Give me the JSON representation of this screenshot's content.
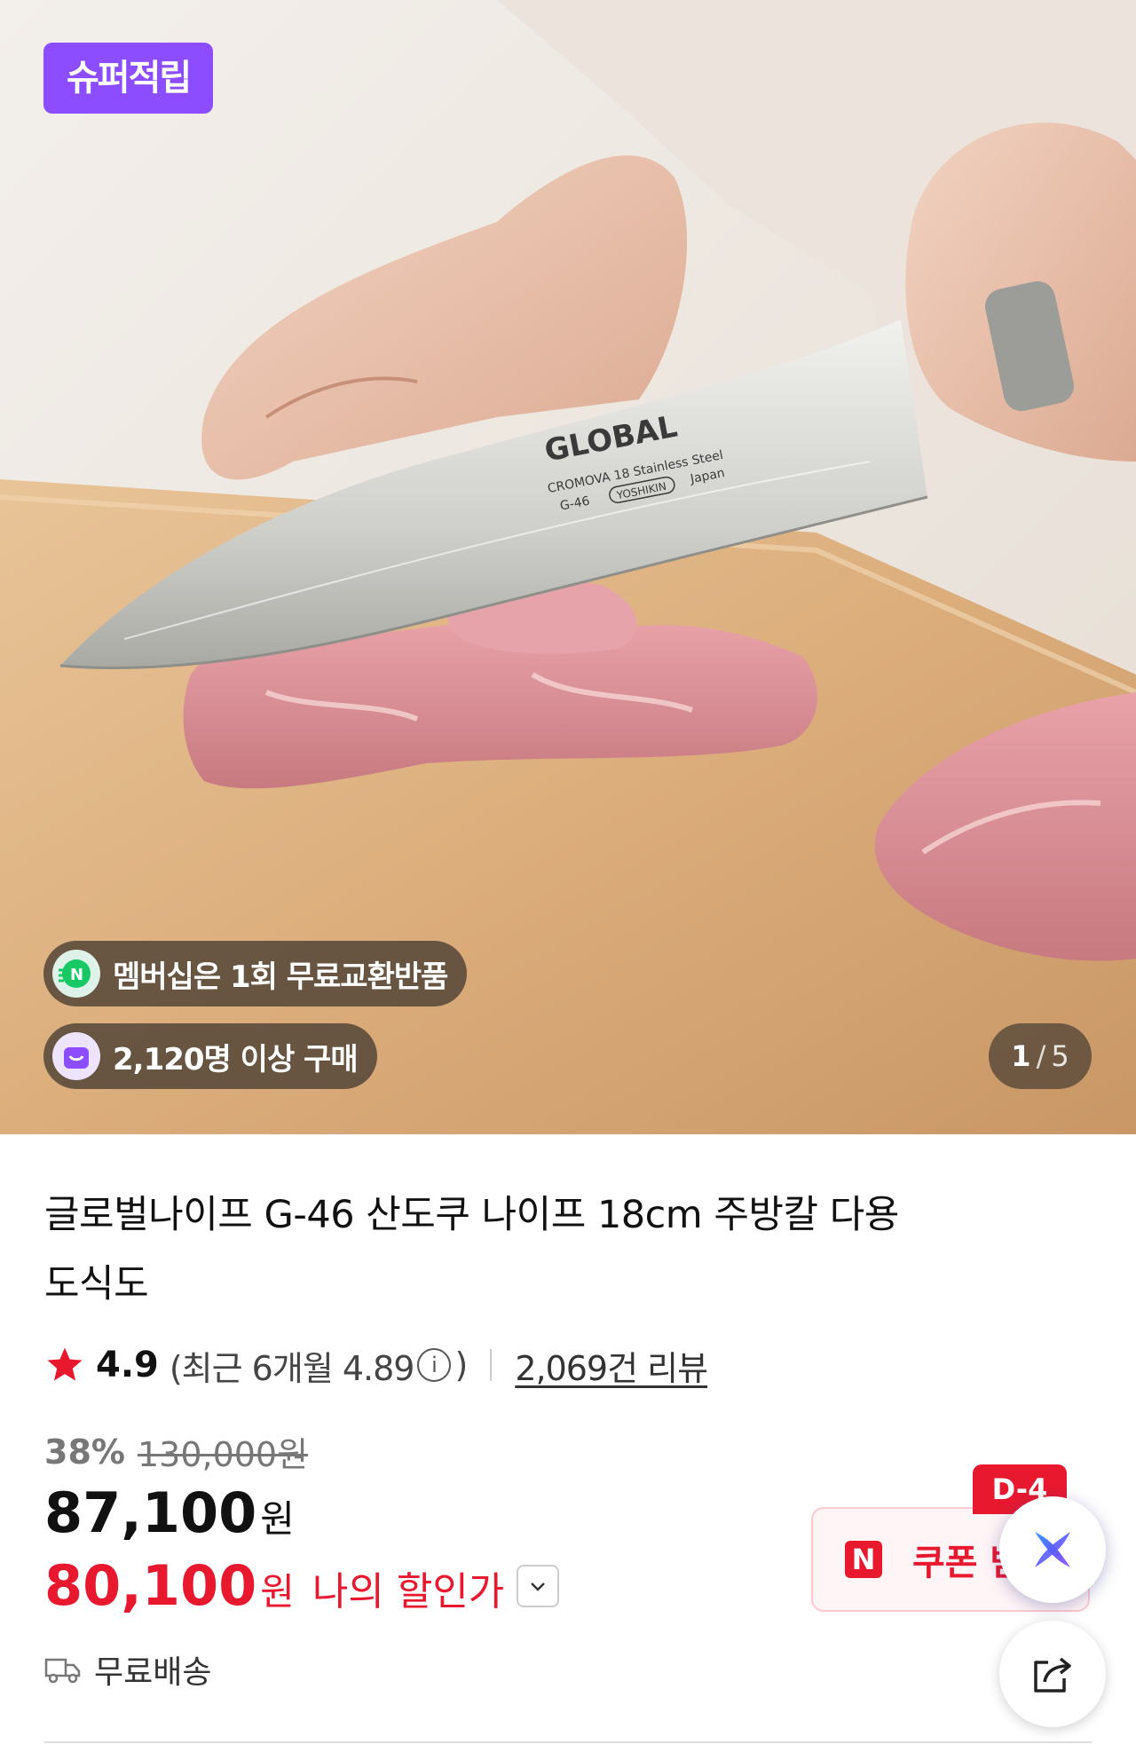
{
  "hero": {
    "badge": "슈퍼적립",
    "knife_brand": "GLOBAL",
    "knife_line1": "CROMOVA 18 Stainless Steel",
    "knife_model": "G-46",
    "knife_maker": "YOSHIKIN",
    "knife_origin": "Japan",
    "membership_pill": "멤버십은 1회 무료교환반품",
    "purchase_pill": "2,120명 이상 구매",
    "counter_current": "1",
    "counter_sep": "/",
    "counter_total": "5",
    "colors": {
      "badge": "#8b4dff",
      "pill_bg": "#463c32"
    }
  },
  "product": {
    "title": "글로벌나이프 G-46 산도쿠 나이프 18cm 주방칼 다용도식도",
    "rating_score": "4.9",
    "rating_recent_prefix": "(최근 6개월 4.89",
    "rating_recent_suffix": ")",
    "review_count": "2,069건 리뷰",
    "discount_rate": "38%",
    "original_price": "130,000원",
    "price_number": "87,100",
    "price_unit": "원",
    "my_price_number": "80,100",
    "my_price_unit": "원",
    "my_price_label": "나의 할인가",
    "shipping": "무료배송",
    "colors": {
      "accent_red": "#e8182f",
      "star": "#e8182f"
    }
  },
  "coupon": {
    "dday": "D-4",
    "brand_mark": "N",
    "label": "쿠폰 받"
  },
  "icons": {
    "info": "info-circle-icon",
    "chevron": "chevron-down-icon",
    "truck": "truck-icon",
    "ai": "ai-assistant-icon",
    "share": "share-icon"
  }
}
